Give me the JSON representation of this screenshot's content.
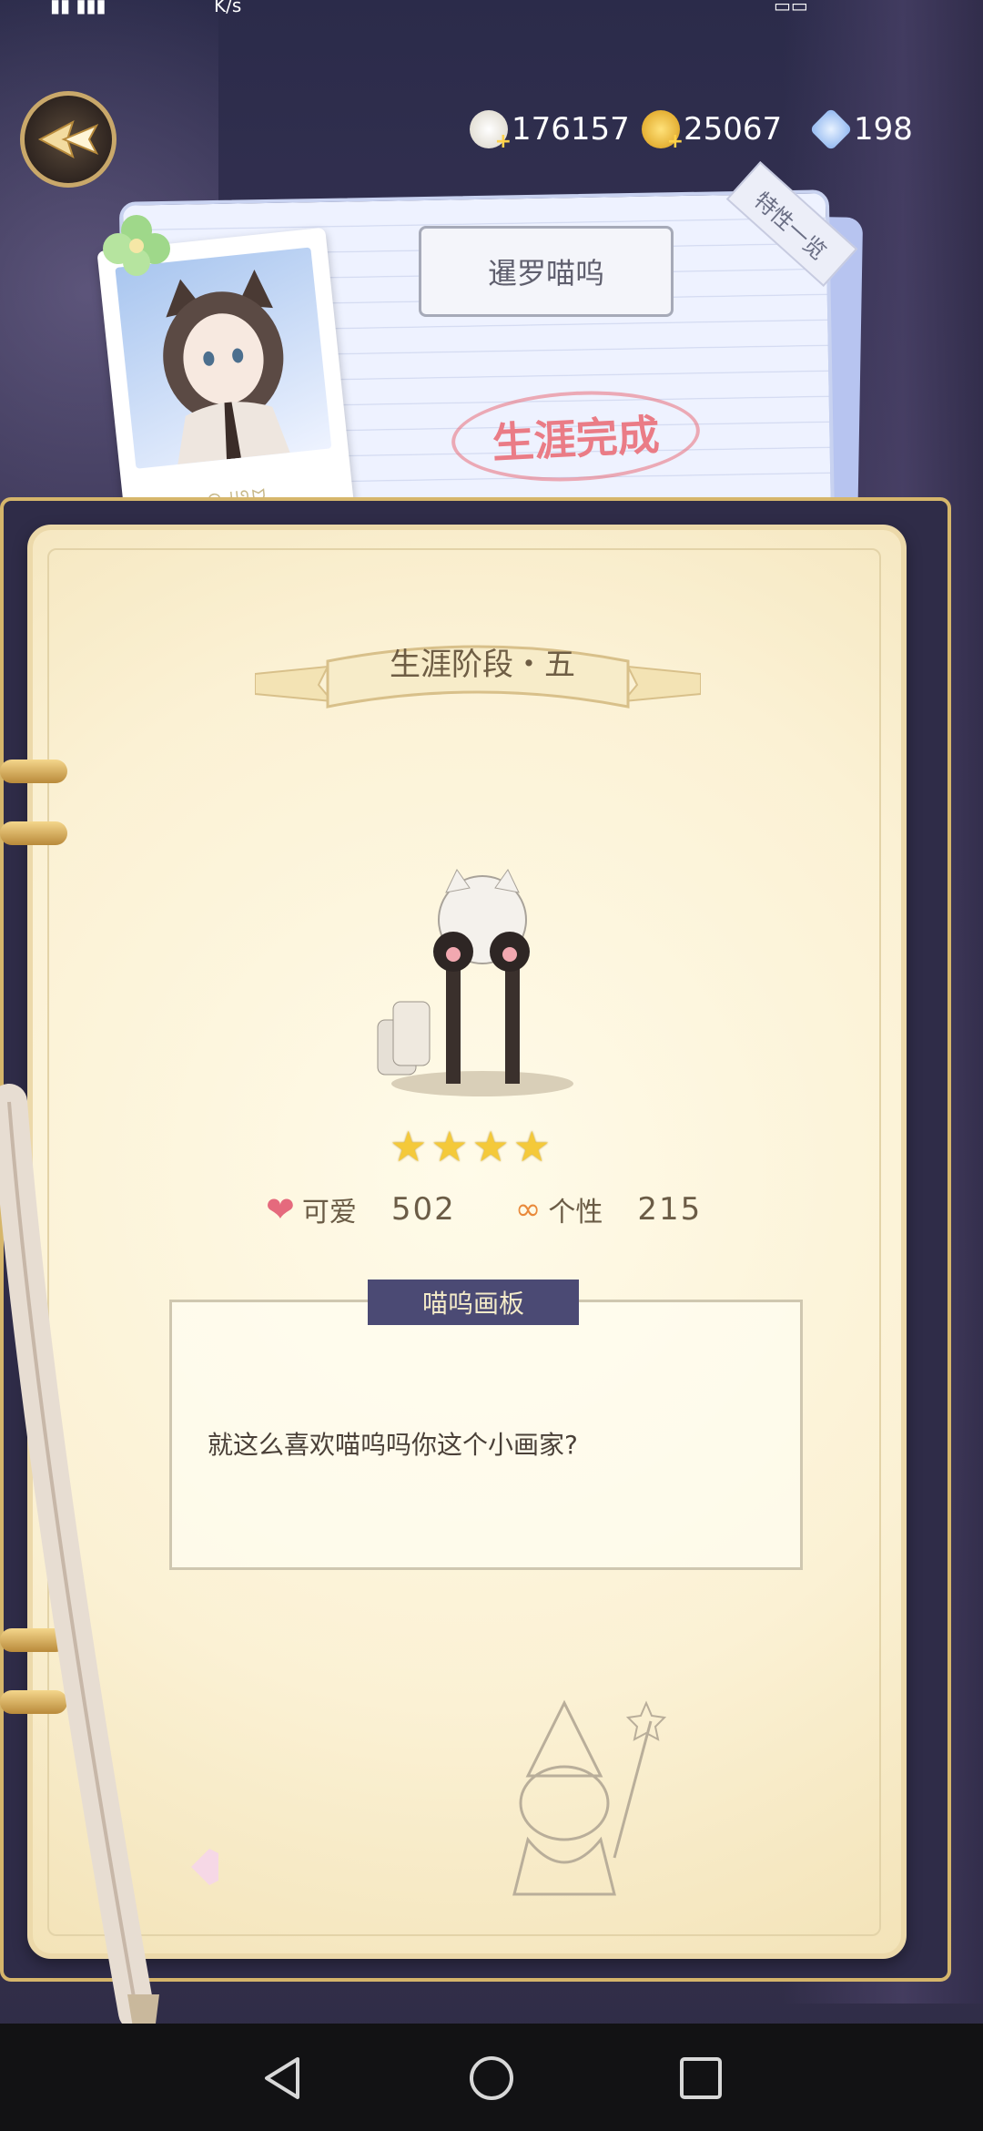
{
  "status_bar": {
    "network_speed": "K/s"
  },
  "currencies": [
    {
      "icon": "shell-icon",
      "value": "176157",
      "color": "#f0eadf"
    },
    {
      "icon": "gold-coin-icon",
      "value": "25067",
      "color": "#f2b632"
    },
    {
      "icon": "crystal-icon",
      "value": "198",
      "color": "#a9c8f6"
    }
  ],
  "card": {
    "character_name": "暹罗喵呜",
    "traits_tab": "特性一览",
    "career_status": "生涯完成"
  },
  "career_stage": {
    "label": "生涯阶段・五"
  },
  "item": {
    "star_count": 4
  },
  "stats": [
    {
      "icon": "heart-icon",
      "label": "可爱",
      "value": "502",
      "color": "#e56a7d"
    },
    {
      "icon": "personality-icon",
      "label": "个性",
      "value": "215",
      "color": "#e98a3b"
    }
  ],
  "message_board": {
    "title": "喵呜画板",
    "message": "就这么喜欢喵呜吗你这个小画家?"
  }
}
